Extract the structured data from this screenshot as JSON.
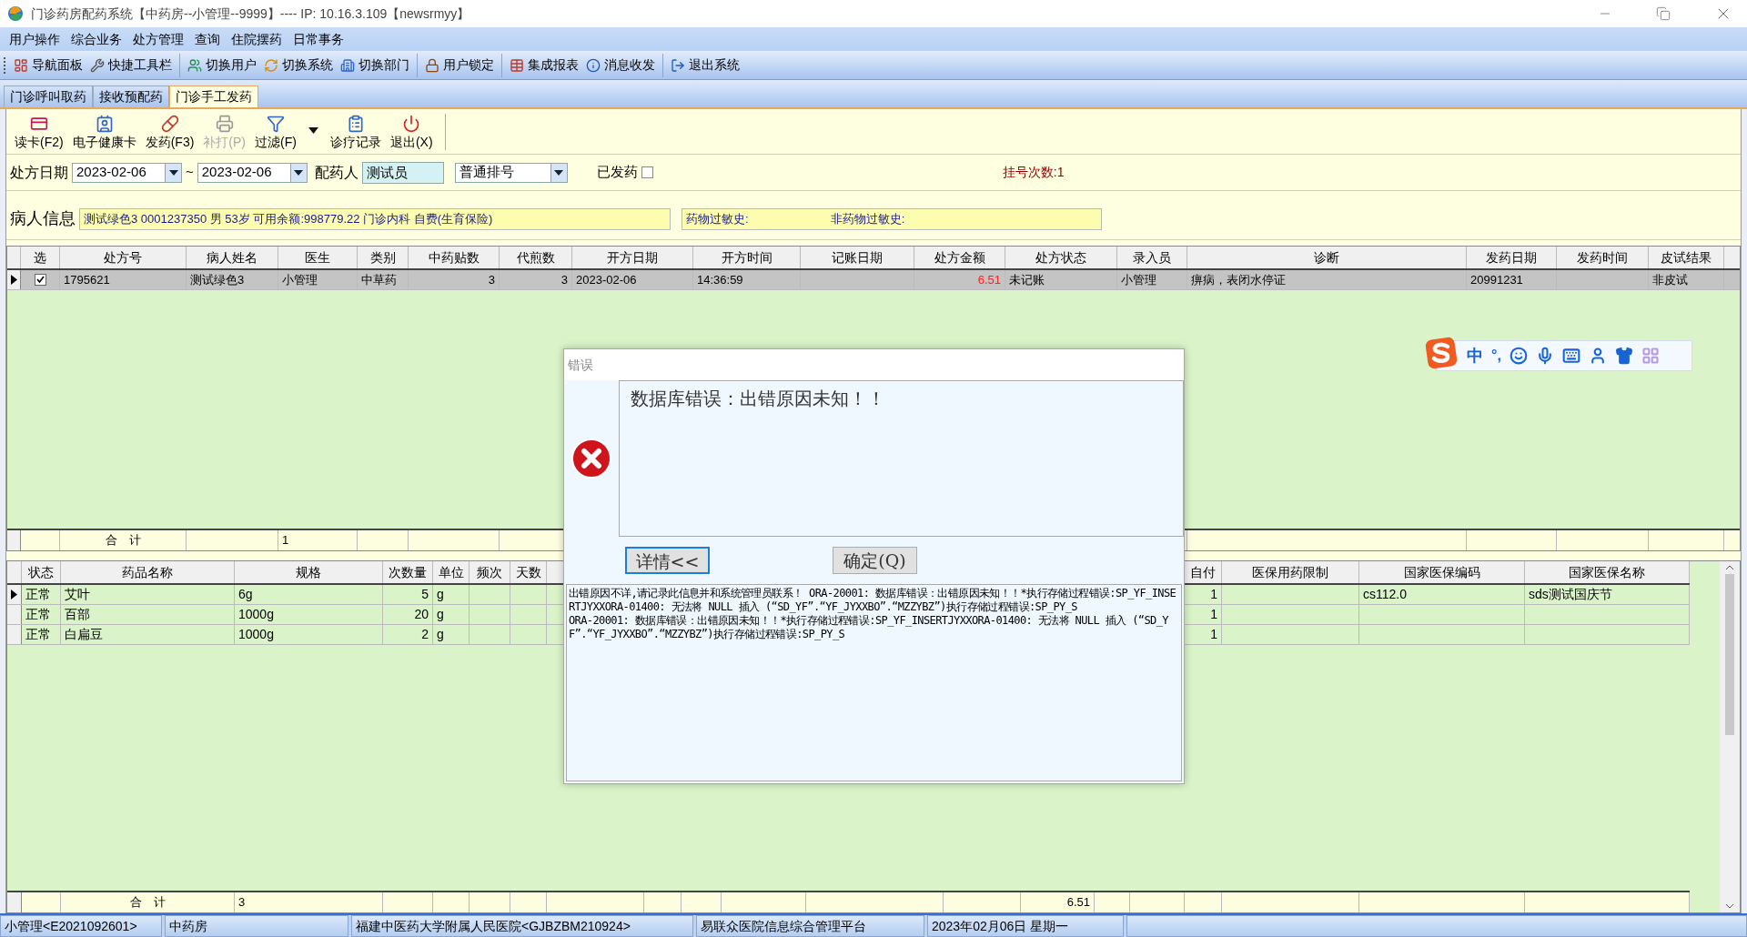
{
  "window": {
    "title": "门诊药房配药系统【中药房--小管理--9999】---- IP: 10.16.3.109【newsrmyy】"
  },
  "menu": [
    "用户操作",
    "综合业务",
    "处方管理",
    "查询",
    "住院摆药",
    "日常事务"
  ],
  "toolbar": [
    [
      "导航面板",
      "快捷工具栏"
    ],
    [
      "切换用户",
      "切换系统",
      "切换部门"
    ],
    [
      "用户锁定"
    ],
    [
      "集成报表",
      "消息收发"
    ],
    [
      "退出系统"
    ]
  ],
  "tabs": [
    {
      "label": "门诊呼叫取药",
      "selected": false
    },
    {
      "label": "接收预配药",
      "selected": false
    },
    {
      "label": "门诊手工发药",
      "selected": true
    }
  ],
  "actions": [
    {
      "label": "读卡(F2)",
      "disabled": false
    },
    {
      "label": "电子健康卡",
      "disabled": false
    },
    {
      "label": "发药(F3)",
      "disabled": false
    },
    {
      "label": "补打(P)",
      "disabled": true
    },
    {
      "label": "过滤(F)",
      "disabled": false,
      "dropdown": true
    },
    {
      "label": "诊疗记录",
      "disabled": false
    },
    {
      "label": "退出(X)",
      "disabled": false
    }
  ],
  "filter": {
    "date_label": "处方日期",
    "date_from": "2023-02-06",
    "separator": "~",
    "date_to": "2023-02-06",
    "dispenser_label": "配药人",
    "dispenser": "测试员",
    "queue_type": "普通排号",
    "dispensed_label": "已发药",
    "dispensed_checked": false,
    "visit_count": "挂号次数:1"
  },
  "patient": {
    "label": "病人信息",
    "info": "测试绿色3 0001237350 男 53岁 可用余额:998779.22 门诊内科 自费(生育保险)",
    "allergy_label": "药物过敏史:",
    "non_drug_allergy_label": "非药物过敏史:"
  },
  "prescriptions": {
    "columns": [
      "选",
      "处方号",
      "病人姓名",
      "医生",
      "类别",
      "中药贴数",
      "代煎数",
      "开方日期",
      "开方时间",
      "记账日期",
      "处方金额",
      "处方状态",
      "录入员",
      "诊断",
      "发药日期",
      "发药时间",
      "皮试结果"
    ],
    "rows": [
      {
        "selected": true,
        "checked": true,
        "cells": {
          "prescription_no": "1795621",
          "patient_name": "测试绿色3",
          "doctor": "小管理",
          "category": "中草药",
          "doses": "3",
          "decoction_count": "3",
          "date": "2023-02-06",
          "time": "14:36:59",
          "amount": "6.51",
          "status": "未记账",
          "entered_by": "小管理",
          "diagnosis": "痹病，表闭水停证",
          "dispense_date": "20991231",
          "skin_test": "非皮试"
        }
      }
    ],
    "total": {
      "label": "合　计",
      "count": "1"
    }
  },
  "drugs": {
    "columns": [
      "状态",
      "药品名称",
      "规格",
      "次数量",
      "单位",
      "频次",
      "天数",
      "自付",
      "医保用药限制",
      "国家医保编码",
      "国家医保名称"
    ],
    "rows": [
      {
        "selected": true,
        "cells": {
          "status": "正常",
          "name": "艾叶",
          "spec": "6g",
          "qty": "5",
          "unit": "g",
          "self_pay": "1",
          "national_code": "cs112.0",
          "national_name": "sds测试国庆节"
        }
      },
      {
        "selected": false,
        "cells": {
          "status": "正常",
          "name": "百部",
          "spec": "1000g",
          "qty": "20",
          "unit": "g",
          "self_pay": "1"
        }
      },
      {
        "selected": false,
        "cells": {
          "status": "正常",
          "name": "白扁豆",
          "spec": "1000g",
          "qty": "2",
          "unit": "g",
          "self_pay": "1"
        }
      }
    ],
    "total": {
      "label": "合　计",
      "count": "3",
      "amount": "6.51"
    }
  },
  "dialog": {
    "title": "错误",
    "message": "数据库错误：出错原因未知！！",
    "buttons": [
      {
        "label": "详情<<",
        "focused": true
      },
      {
        "label": "确定(Q)",
        "focused": false
      }
    ],
    "details": [
      "出错原因不详,请记录此信息并和系统管理员联系！ ORA-20001: 数据库错误：出错原因未知！！*执行存储过程错误:SP_YF_INSERTJYXXORA-01400: 无法将 NULL 插入 (“SD_YF”.“YF_JYXXBO”.“MZZYBZ”)执行存储过程错误:SP_PY_S",
      "ORA-20001: 数据库错误：出错原因未知！！*执行存储过程错误:SP_YF_INSERTJYXXORA-01400: 无法将 NULL 插入 (“SD_YF”.“YF_JYXXBO”.“MZZYBZ”)执行存储过程错误:SP_PY_S"
    ]
  },
  "ime_bar": {
    "mode": "中",
    "punct": "°,"
  },
  "status_bar": [
    "小管理<E2021092601>",
    "中药房",
    "福建中医药大学附属人民医院<GJBZBM210924>",
    "易联众医院信息综合管理平台",
    "2023年02月06日 星期一"
  ]
}
